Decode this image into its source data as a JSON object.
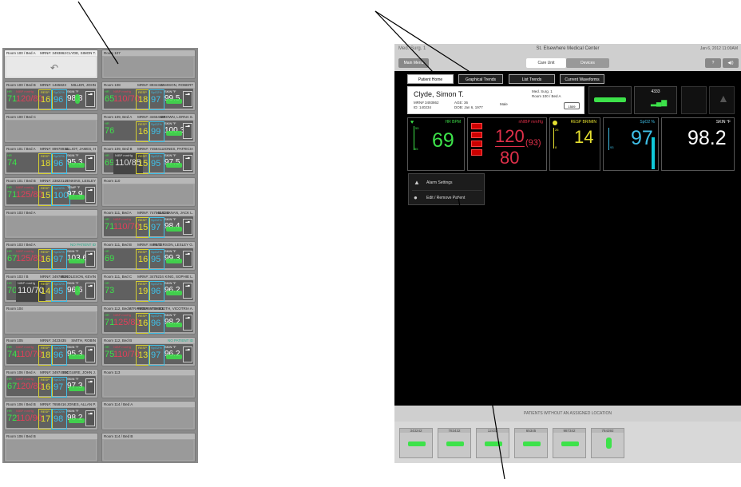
{
  "left_tiles": [
    {
      "room": "Room 100 / Bed A",
      "mrn": "MRN#: 3493862",
      "name": "CLYDE, SIMON T.",
      "state": "selected"
    },
    {
      "room": "Room 107",
      "mrn": "",
      "name": "",
      "state": "empty"
    },
    {
      "room": "Room 100 / Bed B",
      "mrn": "MRN#: 1465823",
      "name": "MILLER, JOHN",
      "hr": "71",
      "nibp": "120/80",
      "nibp_map": "(93)",
      "resp": "16",
      "spo2": "96",
      "skin": "98.8"
    },
    {
      "room": "Room 108",
      "mrn": "MRN#: 8934323",
      "name": "JAMISON, ROBERT",
      "hr": "65",
      "nibp": "110/70",
      "nibp_map": "(83)",
      "resp": "18",
      "spo2": "97",
      "skin": "99.5"
    },
    {
      "room": "Room 100 / Bed C",
      "mrn": "",
      "name": "",
      "state": "empty"
    },
    {
      "room": "Room 109, Bed A",
      "mrn": "MRN#: 34654534",
      "name": "BROWN, LORNA S.",
      "hr": "76",
      "resp": "16",
      "spo2": "99",
      "skin": "100.3"
    },
    {
      "room": "Room 101 / Bed A",
      "mrn": "MRN#: 89978934",
      "name": "ELLIOT, JAMES, H",
      "hr": "74",
      "resp": "18",
      "spo2": "96",
      "skin": "95.3"
    },
    {
      "room": "Room 109, Bed B",
      "mrn": "MRN#: 7458412",
      "name": "JONES, PATRICIA",
      "hr": "69",
      "nibp_gray": "110/85",
      "resp": "15",
      "spo2": "95",
      "skin": "97.5"
    },
    {
      "room": "Room 101 / Bed B",
      "mrn": "MRN#: 2382314",
      "name": "JENKINS, LESLEY",
      "hr": "71",
      "nibp": "125/80",
      "nibp_map": "(95)",
      "resp": "15",
      "spo2": "100",
      "skin": "97.9",
      "skin_label": "TEMP"
    },
    {
      "room": "Room 110",
      "mrn": "",
      "name": "",
      "state": "empty"
    },
    {
      "room": "Room 103 / Bed A",
      "mrn": "",
      "name": "",
      "state": "empty"
    },
    {
      "room": "Room 111, Bed A",
      "mrn": "MRN#: 7475624232",
      "name": "BUCHANAN, JACK L.",
      "hr": "71",
      "nibp": "110/70",
      "nibp_map": "(83)",
      "resp": "15",
      "spo2": "97",
      "skin": "98.4"
    },
    {
      "room": "Room 103 / Bed A",
      "mrn": "",
      "name": "NO PATIENT ID",
      "nopid": true,
      "hr": "67",
      "nibp": "125/80",
      "nibp_map": "(95)",
      "resp": "16",
      "spo2": "97",
      "skin": "103.6"
    },
    {
      "room": "Room 111, Bed B",
      "mrn": "MRN#: 846543",
      "name": "PETERSON, LESLEY G.",
      "hr": "69",
      "resp": "16",
      "spo2": "95",
      "skin": "99.3"
    },
    {
      "room": "Room 103 / B",
      "mrn": "MRN#: 34974534",
      "name": "MENDLESON, KEVIN",
      "hr": "70",
      "nibp_gray": "110/70",
      "nibp_map": "(83)",
      "resp": "14",
      "spo2": "95",
      "skin": "96.6"
    },
    {
      "room": "Room 111, Bed C",
      "mrn": "MRN#: 3479234",
      "name": "KING, SOPHIE L.",
      "hr": "73",
      "resp": "19",
      "spo2": "96",
      "skin": "96.2"
    },
    {
      "room": "Room 104",
      "mrn": "",
      "name": "",
      "state": "empty"
    },
    {
      "room": "Room 112, Bed A",
      "mrn": "MRN#: 9789351",
      "name": "STRANGEWAYS-BOOTH, VICOTRIA A.",
      "hr": "71",
      "nibp": "125/80",
      "nibp_map": "(95)",
      "resp": "16",
      "spo2": "96",
      "skin": "98.2"
    },
    {
      "room": "Room 105",
      "mrn": "MRN#: 3423435",
      "name": "SMITH, ROBIN",
      "hr": "74",
      "nibp": "110/70",
      "nibp_map": "(83)",
      "resp": "18",
      "spo2": "96",
      "skin": "95.3"
    },
    {
      "room": "Room 112, Bed B",
      "mrn": "",
      "name": "NO PATIENT ID",
      "nopid": true,
      "hr": "75",
      "nibp": "110/70",
      "nibp_map": "(83)",
      "resp": "13",
      "spo2": "97",
      "skin": "96.2"
    },
    {
      "room": "Room 106 / Bed A",
      "mrn": "MRN#: 34974534",
      "name": "MCGUIRE, JOHN J.",
      "hr": "67",
      "nibp": "120/80",
      "nibp_map": "(93)",
      "resp": "16",
      "spo2": "97",
      "skin": "97.3"
    },
    {
      "room": "Room 113",
      "mrn": "",
      "name": "",
      "state": "empty"
    },
    {
      "room": "Room 106 / Bed B",
      "mrn": "MRN#: 7658416",
      "name": "JONES, ALLAN P.",
      "hr": "72",
      "nibp": "110/90",
      "nibp_map": "(83)",
      "resp": "17",
      "spo2": "98",
      "skin": "98.2"
    },
    {
      "room": "Room 114 / Bed A",
      "mrn": "",
      "name": "",
      "state": "empty"
    },
    {
      "room": "Room 106 / Bed B",
      "mrn": "",
      "name": "",
      "state": "empty"
    },
    {
      "room": "Room 114 / Bed B",
      "mrn": "",
      "name": "",
      "state": "empty"
    }
  ],
  "header": {
    "unit": "Med. Surg. 1",
    "title": "St. Elsewhere Medical Center",
    "date": "Jan 6, 2012  11:00AM",
    "main_btn": "Main Menu",
    "seg_care": "Care Unit",
    "seg_devices": "Devices",
    "help": "?",
    "sound": "◀))"
  },
  "tabs": [
    "Patient Home",
    "Graphical Trends",
    "List Trends",
    "Current Waveforms"
  ],
  "patient": {
    "name": "Clyde, Simon T.",
    "mrn": "MRN# 3493862",
    "id": "ID: 140234",
    "age": "AGE: 36",
    "dob": "DOB: Jan 6, 1977",
    "sex": "Male",
    "unit": "Med. Surg. 1",
    "room": "Room 100 / Bed A",
    "status_btn": "1509",
    "bed_id": "4333"
  },
  "vitals": {
    "hr_label": "HR BPM",
    "hr": "69",
    "hr_hi": "55",
    "hr_lo": "55",
    "nibp_label": "nNIBP mmHg",
    "nibp_sys": "120",
    "nibp_dia": "80",
    "nibp_map": "(93)",
    "resp_label": "RESP BR/MIN",
    "resp": "14",
    "resp_hi": "26",
    "resp_lo": "8",
    "spo2_label": "SpO2 %",
    "spo2": "97",
    "spo2_lo": "93",
    "skin_label": "SKIN °F",
    "skin": "98.2"
  },
  "menu": {
    "alarm": "Alarm Settings",
    "edit": "Edit / Remove Patient"
  },
  "unassigned": {
    "title": "PATIENTS WITHOUT AN ASSIGNED LOCATION",
    "ids": [
      "343242",
      "783432",
      "12432",
      "65345",
      "987342",
      "784392"
    ]
  }
}
